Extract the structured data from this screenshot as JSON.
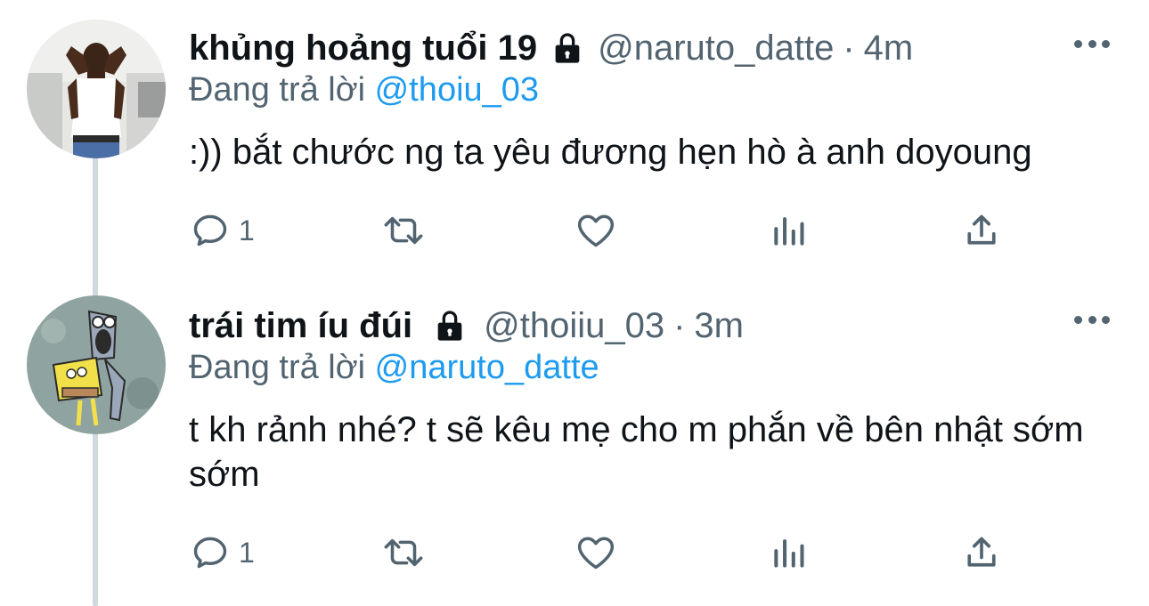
{
  "tweets": [
    {
      "display_name": "khủng hoảng tuổi 19",
      "handle": "@naruto_datte",
      "separator": "·",
      "time": "4m",
      "reply_prefix": "Đang trả lời",
      "reply_to": "@thoiu_03",
      "text": ":)) bắt chước ng ta yêu đương hẹn hò à anh doyoung",
      "reply_count": "1",
      "icons": [
        "reply-icon",
        "retweet-icon",
        "like-icon",
        "views-icon",
        "share-icon"
      ]
    },
    {
      "display_name": "trái tim íu đúi",
      "handle": "@thoiiu_03",
      "separator": "·",
      "time": "3m",
      "reply_prefix": "Đang trả lời",
      "reply_to": "@naruto_datte",
      "text": "t kh rảnh nhé? t sẽ kêu mẹ cho m phắn về bên nhật sớm sớm",
      "reply_count": "1",
      "icons": [
        "reply-icon",
        "retweet-icon",
        "like-icon",
        "views-icon",
        "share-icon"
      ]
    }
  ],
  "colors": {
    "text": "#0f1419",
    "secondary": "#536471",
    "mention": "#1d9bf0",
    "thread_line": "#cfd9de"
  }
}
